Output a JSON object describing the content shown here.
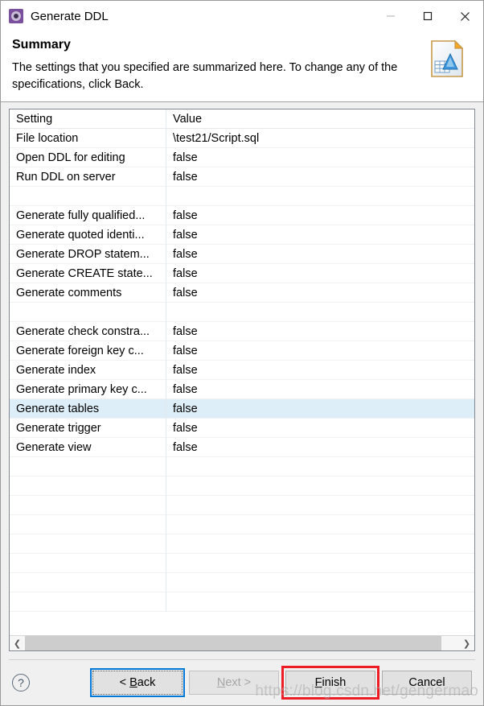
{
  "window": {
    "title": "Generate DDL",
    "app_icon": "gear-icon",
    "controls": {
      "minimize": "—",
      "maximize": "□",
      "close": "✕"
    }
  },
  "header": {
    "title": "Summary",
    "description": "The settings that you specified are summarized here. To change any of the specifications, click Back.",
    "icon": "script-document-icon"
  },
  "table": {
    "columns": [
      "Setting",
      "Value"
    ],
    "rows": [
      {
        "setting": "File location",
        "value": "\\test21/Script.sql",
        "selected": false
      },
      {
        "setting": "Open DDL for editing",
        "value": "false",
        "selected": false
      },
      {
        "setting": "Run DDL on server",
        "value": "false",
        "selected": false
      },
      {
        "setting": "",
        "value": "",
        "selected": false
      },
      {
        "setting": "Generate fully qualified...",
        "value": "false",
        "selected": false
      },
      {
        "setting": "Generate quoted identi...",
        "value": "false",
        "selected": false
      },
      {
        "setting": "Generate DROP statem...",
        "value": "false",
        "selected": false
      },
      {
        "setting": "Generate CREATE state...",
        "value": "false",
        "selected": false
      },
      {
        "setting": "Generate comments",
        "value": "false",
        "selected": false
      },
      {
        "setting": "",
        "value": "",
        "selected": false
      },
      {
        "setting": "Generate check constra...",
        "value": "false",
        "selected": false
      },
      {
        "setting": "Generate foreign key c...",
        "value": "false",
        "selected": false
      },
      {
        "setting": "Generate index",
        "value": "false",
        "selected": false
      },
      {
        "setting": "Generate primary key c...",
        "value": "false",
        "selected": false
      },
      {
        "setting": "Generate tables",
        "value": "false",
        "selected": true
      },
      {
        "setting": "Generate trigger",
        "value": "false",
        "selected": false
      },
      {
        "setting": "Generate view",
        "value": "false",
        "selected": false
      },
      {
        "setting": "",
        "value": "",
        "selected": false
      },
      {
        "setting": "",
        "value": "",
        "selected": false
      },
      {
        "setting": "",
        "value": "",
        "selected": false
      },
      {
        "setting": "",
        "value": "",
        "selected": false
      },
      {
        "setting": "",
        "value": "",
        "selected": false
      },
      {
        "setting": "",
        "value": "",
        "selected": false
      },
      {
        "setting": "",
        "value": "",
        "selected": false
      },
      {
        "setting": "",
        "value": "",
        "selected": false
      }
    ]
  },
  "scrollbar": {
    "left_arrow": "❮",
    "right_arrow": "❯"
  },
  "footer": {
    "help": "?",
    "buttons": {
      "back": "< Back",
      "next": "Next >",
      "finish": "Finish",
      "cancel": "Cancel"
    },
    "back_enabled": true,
    "next_enabled": false
  },
  "annotation": {
    "highlight_target": "finish-button",
    "color": "#ee1c25"
  },
  "watermark": "https://blog.csdn.net/gengermao",
  "colors": {
    "selection": "#ddeef8",
    "focus": "#0078d7",
    "annotation": "#ee1c25",
    "window_bg": "#f0f0f0"
  }
}
